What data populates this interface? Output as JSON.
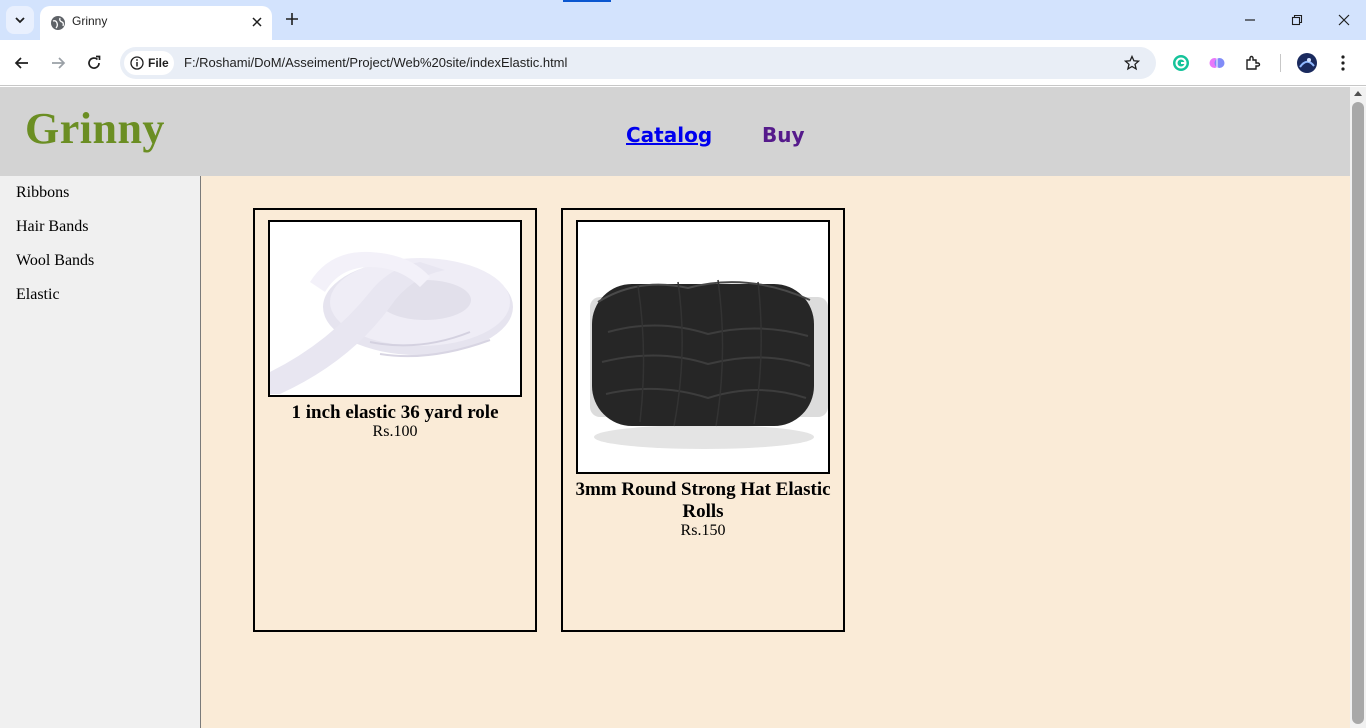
{
  "browser": {
    "tab_title": "Grinny",
    "address": "F:/Roshami/DoM/Asseiment/Project/Web%20site/indexElastic.html",
    "site_chip_label": "File"
  },
  "header": {
    "logo": "Grinny",
    "nav": [
      {
        "label": "Catalog"
      },
      {
        "label": "Buy"
      }
    ]
  },
  "sidebar": {
    "items": [
      {
        "label": "Ribbons"
      },
      {
        "label": "Hair Bands"
      },
      {
        "label": "Wool Bands"
      },
      {
        "label": "Elastic"
      }
    ]
  },
  "products": [
    {
      "name": "1 inch elastic 36 yard role",
      "price": "Rs.100"
    },
    {
      "name": "3mm Round Strong Hat Elastic Rolls",
      "price": "Rs.150"
    }
  ],
  "colors": {
    "logo": "#6b8e23",
    "header_bg": "#d3d3d3",
    "content_bg": "#faebd7",
    "link_catalog": "#0000ee",
    "link_buy_visited": "#551a8b"
  }
}
